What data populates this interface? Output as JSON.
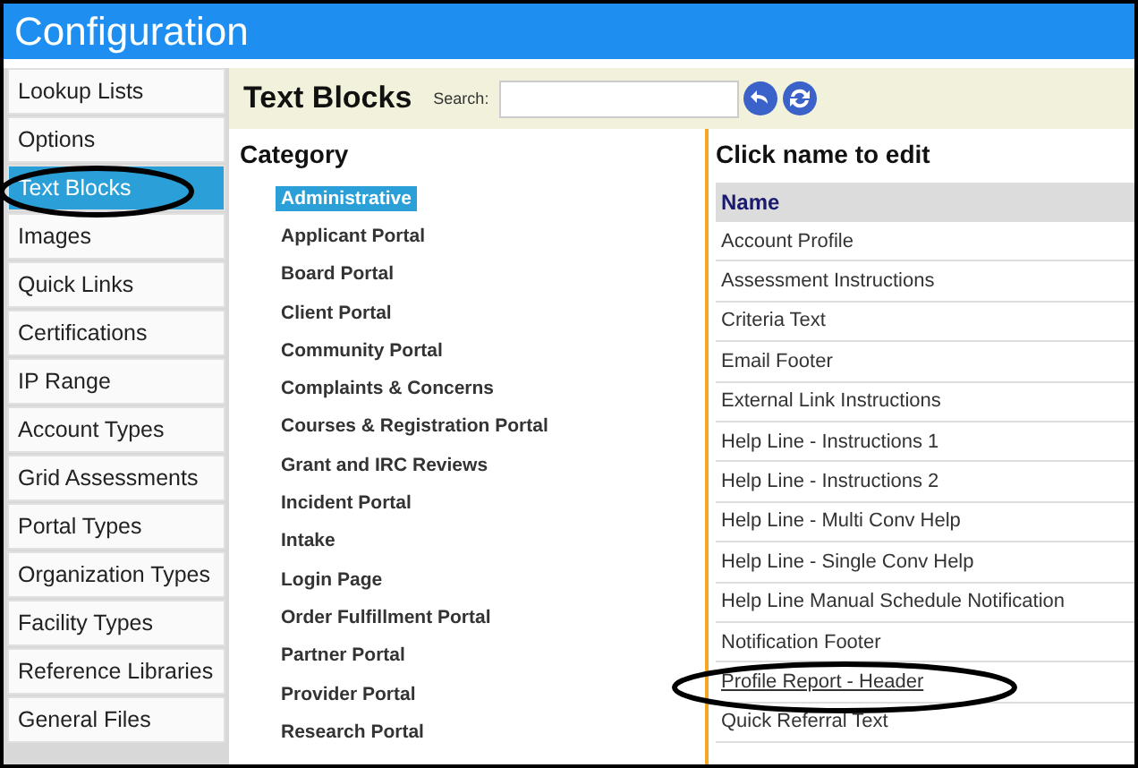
{
  "window": {
    "title": "Configuration"
  },
  "sidebar": {
    "items": [
      {
        "label": "Lookup Lists",
        "selected": false
      },
      {
        "label": "Options",
        "selected": false
      },
      {
        "label": "Text Blocks",
        "selected": true
      },
      {
        "label": "Images",
        "selected": false
      },
      {
        "label": "Quick Links",
        "selected": false
      },
      {
        "label": "Certifications",
        "selected": false
      },
      {
        "label": "IP Range",
        "selected": false
      },
      {
        "label": "Account Types",
        "selected": false
      },
      {
        "label": "Grid Assessments",
        "selected": false
      },
      {
        "label": "Portal Types",
        "selected": false
      },
      {
        "label": "Organization Types",
        "selected": false
      },
      {
        "label": "Facility Types",
        "selected": false
      },
      {
        "label": "Reference Libraries",
        "selected": false
      },
      {
        "label": "General Files",
        "selected": false
      }
    ]
  },
  "header": {
    "title": "Text Blocks",
    "search_label": "Search:"
  },
  "category": {
    "heading": "Category",
    "items": [
      {
        "label": "Administrative",
        "selected": true
      },
      {
        "label": "Applicant Portal",
        "selected": false
      },
      {
        "label": "Board Portal",
        "selected": false
      },
      {
        "label": "Client Portal",
        "selected": false
      },
      {
        "label": "Community Portal",
        "selected": false
      },
      {
        "label": "Complaints & Concerns",
        "selected": false
      },
      {
        "label": "Courses & Registration Portal",
        "selected": false
      },
      {
        "label": "Grant and IRC Reviews",
        "selected": false
      },
      {
        "label": "Incident Portal",
        "selected": false
      },
      {
        "label": "Intake",
        "selected": false
      },
      {
        "label": "Login Page",
        "selected": false
      },
      {
        "label": "Order Fulfillment Portal",
        "selected": false
      },
      {
        "label": "Partner Portal",
        "selected": false
      },
      {
        "label": "Provider Portal",
        "selected": false
      },
      {
        "label": "Research Portal",
        "selected": false
      }
    ]
  },
  "names": {
    "heading": "Click name to edit",
    "column": "Name",
    "rows": [
      {
        "label": "Account Profile",
        "underlined": false
      },
      {
        "label": "Assessment Instructions",
        "underlined": false
      },
      {
        "label": "Criteria Text",
        "underlined": false
      },
      {
        "label": "Email Footer",
        "underlined": false
      },
      {
        "label": "External Link Instructions",
        "underlined": false
      },
      {
        "label": "Help Line - Instructions 1",
        "underlined": false
      },
      {
        "label": "Help Line - Instructions 2",
        "underlined": false
      },
      {
        "label": "Help Line - Multi Conv Help",
        "underlined": false
      },
      {
        "label": "Help Line - Single Conv Help",
        "underlined": false
      },
      {
        "label": "Help Line Manual Schedule Notification",
        "underlined": false
      },
      {
        "label": "Notification Footer",
        "underlined": false
      },
      {
        "label": "Profile Report - Header",
        "underlined": true
      },
      {
        "label": "Quick Referral Text",
        "underlined": false
      }
    ]
  }
}
